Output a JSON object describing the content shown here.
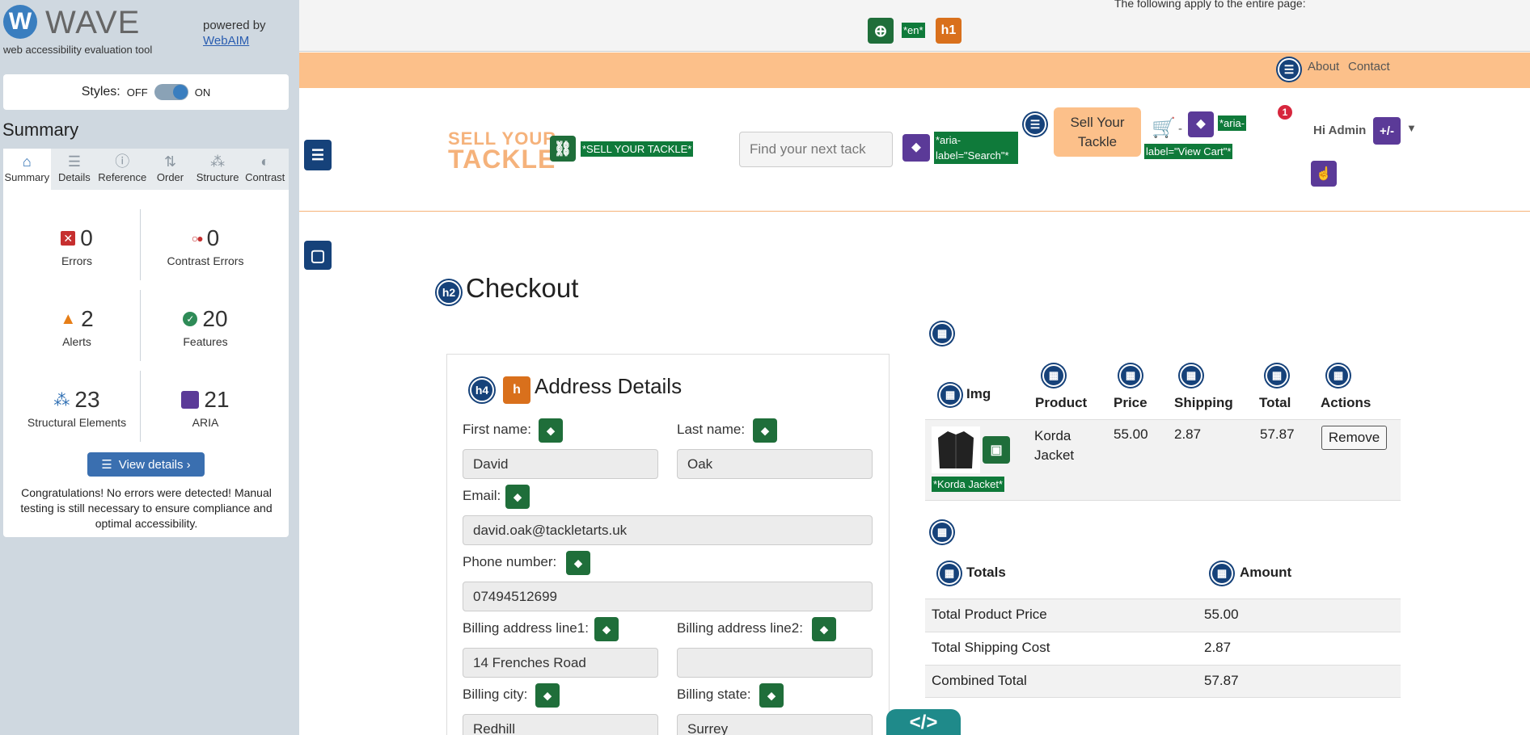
{
  "wave": {
    "brand": "WAVE",
    "logo_letter": "W",
    "tagline": "web accessibility evaluation tool",
    "powered_by": "powered by",
    "webaim": "WebAIM",
    "styles_label": "Styles:",
    "styles_off": "OFF",
    "styles_on": "ON",
    "summary_title": "Summary",
    "tabs": [
      {
        "label": "Summary",
        "icon": "home-icon"
      },
      {
        "label": "Details",
        "icon": "list-icon"
      },
      {
        "label": "Reference",
        "icon": "info-icon"
      },
      {
        "label": "Order",
        "icon": "order-icon"
      },
      {
        "label": "Structure",
        "icon": "structure-icon"
      },
      {
        "label": "Contrast",
        "icon": "contrast-icon"
      }
    ],
    "stats": [
      {
        "value": "0",
        "label": "Errors"
      },
      {
        "value": "0",
        "label": "Contrast Errors"
      },
      {
        "value": "2",
        "label": "Alerts"
      },
      {
        "value": "20",
        "label": "Features"
      },
      {
        "value": "23",
        "label": "Structural Elements"
      },
      {
        "value": "21",
        "label": "ARIA"
      }
    ],
    "view_details": "View details ›",
    "congrats": "Congratulations! No errors were detected! Manual testing is still necessary to ensure compliance and optimal accessibility.",
    "colors": {
      "accent": "#3a6fb0",
      "error": "#c62f2f",
      "alert": "#e67e17",
      "feature": "#2e8b57",
      "aria": "#5b3a98"
    }
  },
  "page": {
    "top_note": "The following apply to the entire page:",
    "lang_label": "*en*",
    "h1_badge": "h1",
    "nav": {
      "about": "About",
      "contact": "Contact"
    },
    "logo_text_1": "SELL YOUR",
    "logo_text_2": "TACKLE",
    "logo_alt": "*SELL YOUR TACKLE*",
    "search_placeholder": "Find your next tack",
    "search_aria_1": "*aria-",
    "search_aria_2": "label=\"Search\"*",
    "sell_btn_1": "Sell Your",
    "sell_btn_2": "Tackle",
    "cart_dash": "-",
    "cart_aria_1": "*aria-",
    "cart_aria_2": "label=\"View Cart\"*",
    "cart_badge": "1",
    "hi_admin": "Hi Admin",
    "plusminus": "+/-",
    "h2_badge": "h2",
    "checkout_title": "Checkout",
    "h4_badge": "h4",
    "h_badge": "h",
    "address_title": "Address Details",
    "form": {
      "first_name_label": "First name:",
      "first_name": "David",
      "last_name_label": "Last name:",
      "last_name": "Oak",
      "email_label": "Email:",
      "email": "david.oak@tackletarts.uk",
      "phone_label": "Phone number:",
      "phone": "07494512699",
      "addr1_label": "Billing address line1:",
      "addr1": "14 Frenches Road",
      "addr2_label": "Billing address line2:",
      "addr2": "",
      "city_label": "Billing city:",
      "city": "Redhill",
      "state_label": "Billing state:",
      "state": "Surrey"
    },
    "cart_table": {
      "headers": [
        "Img",
        "Product",
        "Price",
        "Shipping",
        "Total",
        "Actions"
      ],
      "row": {
        "product_1": "Korda",
        "product_2": "Jacket",
        "price": "55.00",
        "shipping": "2.87",
        "total": "57.87",
        "action": "Remove",
        "img_alt": "*Korda Jacket*"
      }
    },
    "totals_table": {
      "headers": [
        "Totals",
        "Amount"
      ],
      "rows": [
        {
          "label": "Total Product Price",
          "value": "55.00"
        },
        {
          "label": "Total Shipping Cost",
          "value": "2.87"
        },
        {
          "label": "Combined Total",
          "value": "57.87"
        }
      ]
    },
    "code_tab": "</>"
  }
}
